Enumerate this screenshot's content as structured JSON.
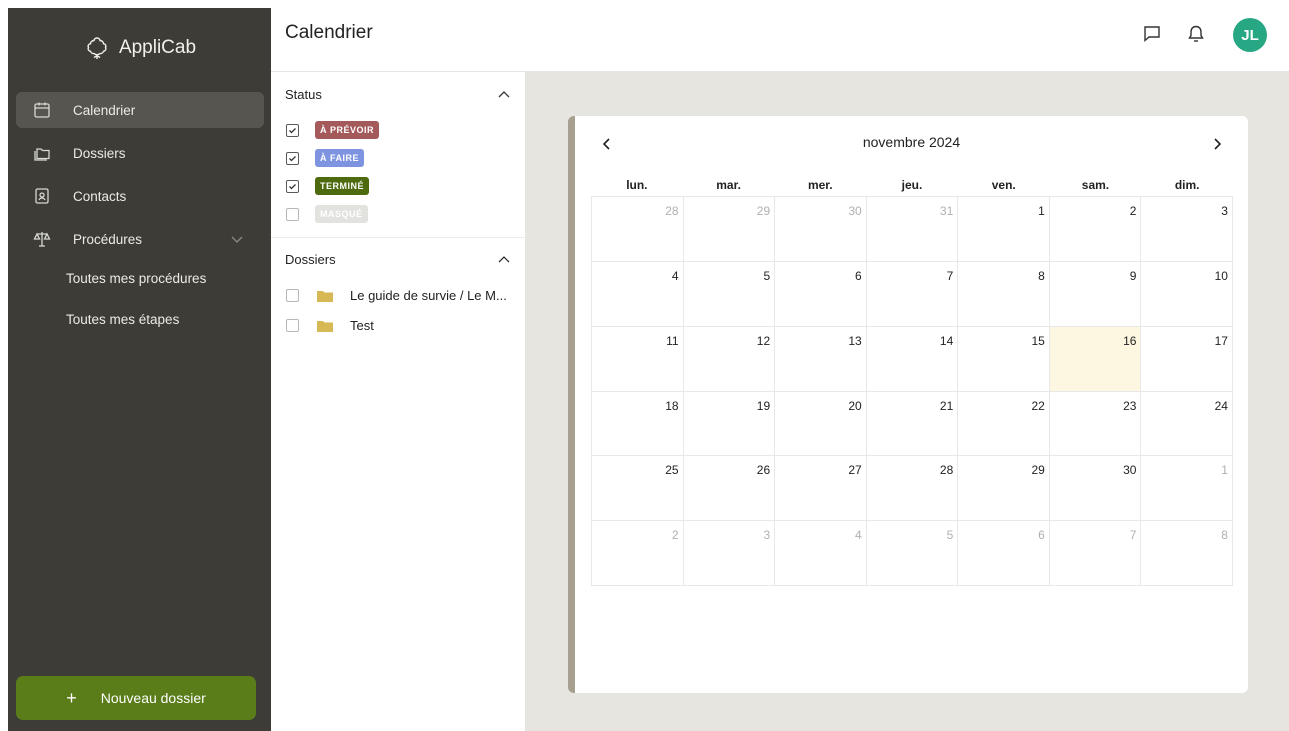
{
  "sidebar": {
    "brand": "AppliCab",
    "nav": [
      {
        "label": "Calendrier",
        "icon": "calendar-icon",
        "active": true
      },
      {
        "label": "Dossiers",
        "icon": "folders-icon"
      },
      {
        "label": "Contacts",
        "icon": "contact-icon"
      },
      {
        "label": "Procédures",
        "icon": "scales-icon"
      }
    ],
    "sub_items": [
      "Toutes mes procédures",
      "Toutes mes étapes"
    ],
    "new_button": {
      "icon": "+",
      "label": "Nouveau dossier"
    }
  },
  "header": {
    "title": "Calendrier",
    "avatar": "JL",
    "icons": [
      "chat-icon",
      "bell-icon"
    ]
  },
  "filters": {
    "status": {
      "title": "Status",
      "items": [
        {
          "label": "À PRÉVOIR",
          "checked": true,
          "color": "#a45a5a"
        },
        {
          "label": "À FAIRE",
          "checked": true,
          "color": "#7e94e0"
        },
        {
          "label": "TERMINÉ",
          "checked": true,
          "color": "#4d6b0e"
        },
        {
          "label": "MASQUÉ",
          "checked": false,
          "color": "#e2e2df"
        }
      ]
    },
    "dossiers": {
      "title": "Dossiers",
      "items": [
        {
          "label": "Le guide de survie / Le M...",
          "checked": false
        },
        {
          "label": "Test",
          "checked": false
        }
      ]
    }
  },
  "calendar": {
    "month": "novembre 2024",
    "prev": "‹",
    "next": "›",
    "weekdays": [
      "lun.",
      "mar.",
      "mer.",
      "jeu.",
      "ven.",
      "sam.",
      "dim."
    ],
    "days": [
      [
        "28",
        "29",
        "30",
        "31",
        "1",
        "2",
        "3"
      ],
      [
        "4",
        "5",
        "6",
        "7",
        "8",
        "9",
        "10"
      ],
      [
        "11",
        "12",
        "13",
        "14",
        "15",
        "16",
        "17"
      ],
      [
        "18",
        "19",
        "20",
        "21",
        "22",
        "23",
        "24"
      ],
      [
        "25",
        "26",
        "27",
        "28",
        "29",
        "30",
        "1"
      ],
      [
        "2",
        "3",
        "4",
        "5",
        "6",
        "7",
        "8"
      ]
    ],
    "muted": [
      [
        0,
        0
      ],
      [
        0,
        1
      ],
      [
        0,
        2
      ],
      [
        0,
        3
      ],
      [
        4,
        6
      ],
      [
        5,
        0
      ],
      [
        5,
        1
      ],
      [
        5,
        2
      ],
      [
        5,
        3
      ],
      [
        5,
        4
      ],
      [
        5,
        5
      ],
      [
        5,
        6
      ]
    ],
    "today": [
      2,
      5
    ]
  },
  "colors": {
    "sidebar": "#3d3c37",
    "accent": "#5a7d1a",
    "avatar": "#27a783",
    "today_highlight": "#fdf7e1"
  }
}
